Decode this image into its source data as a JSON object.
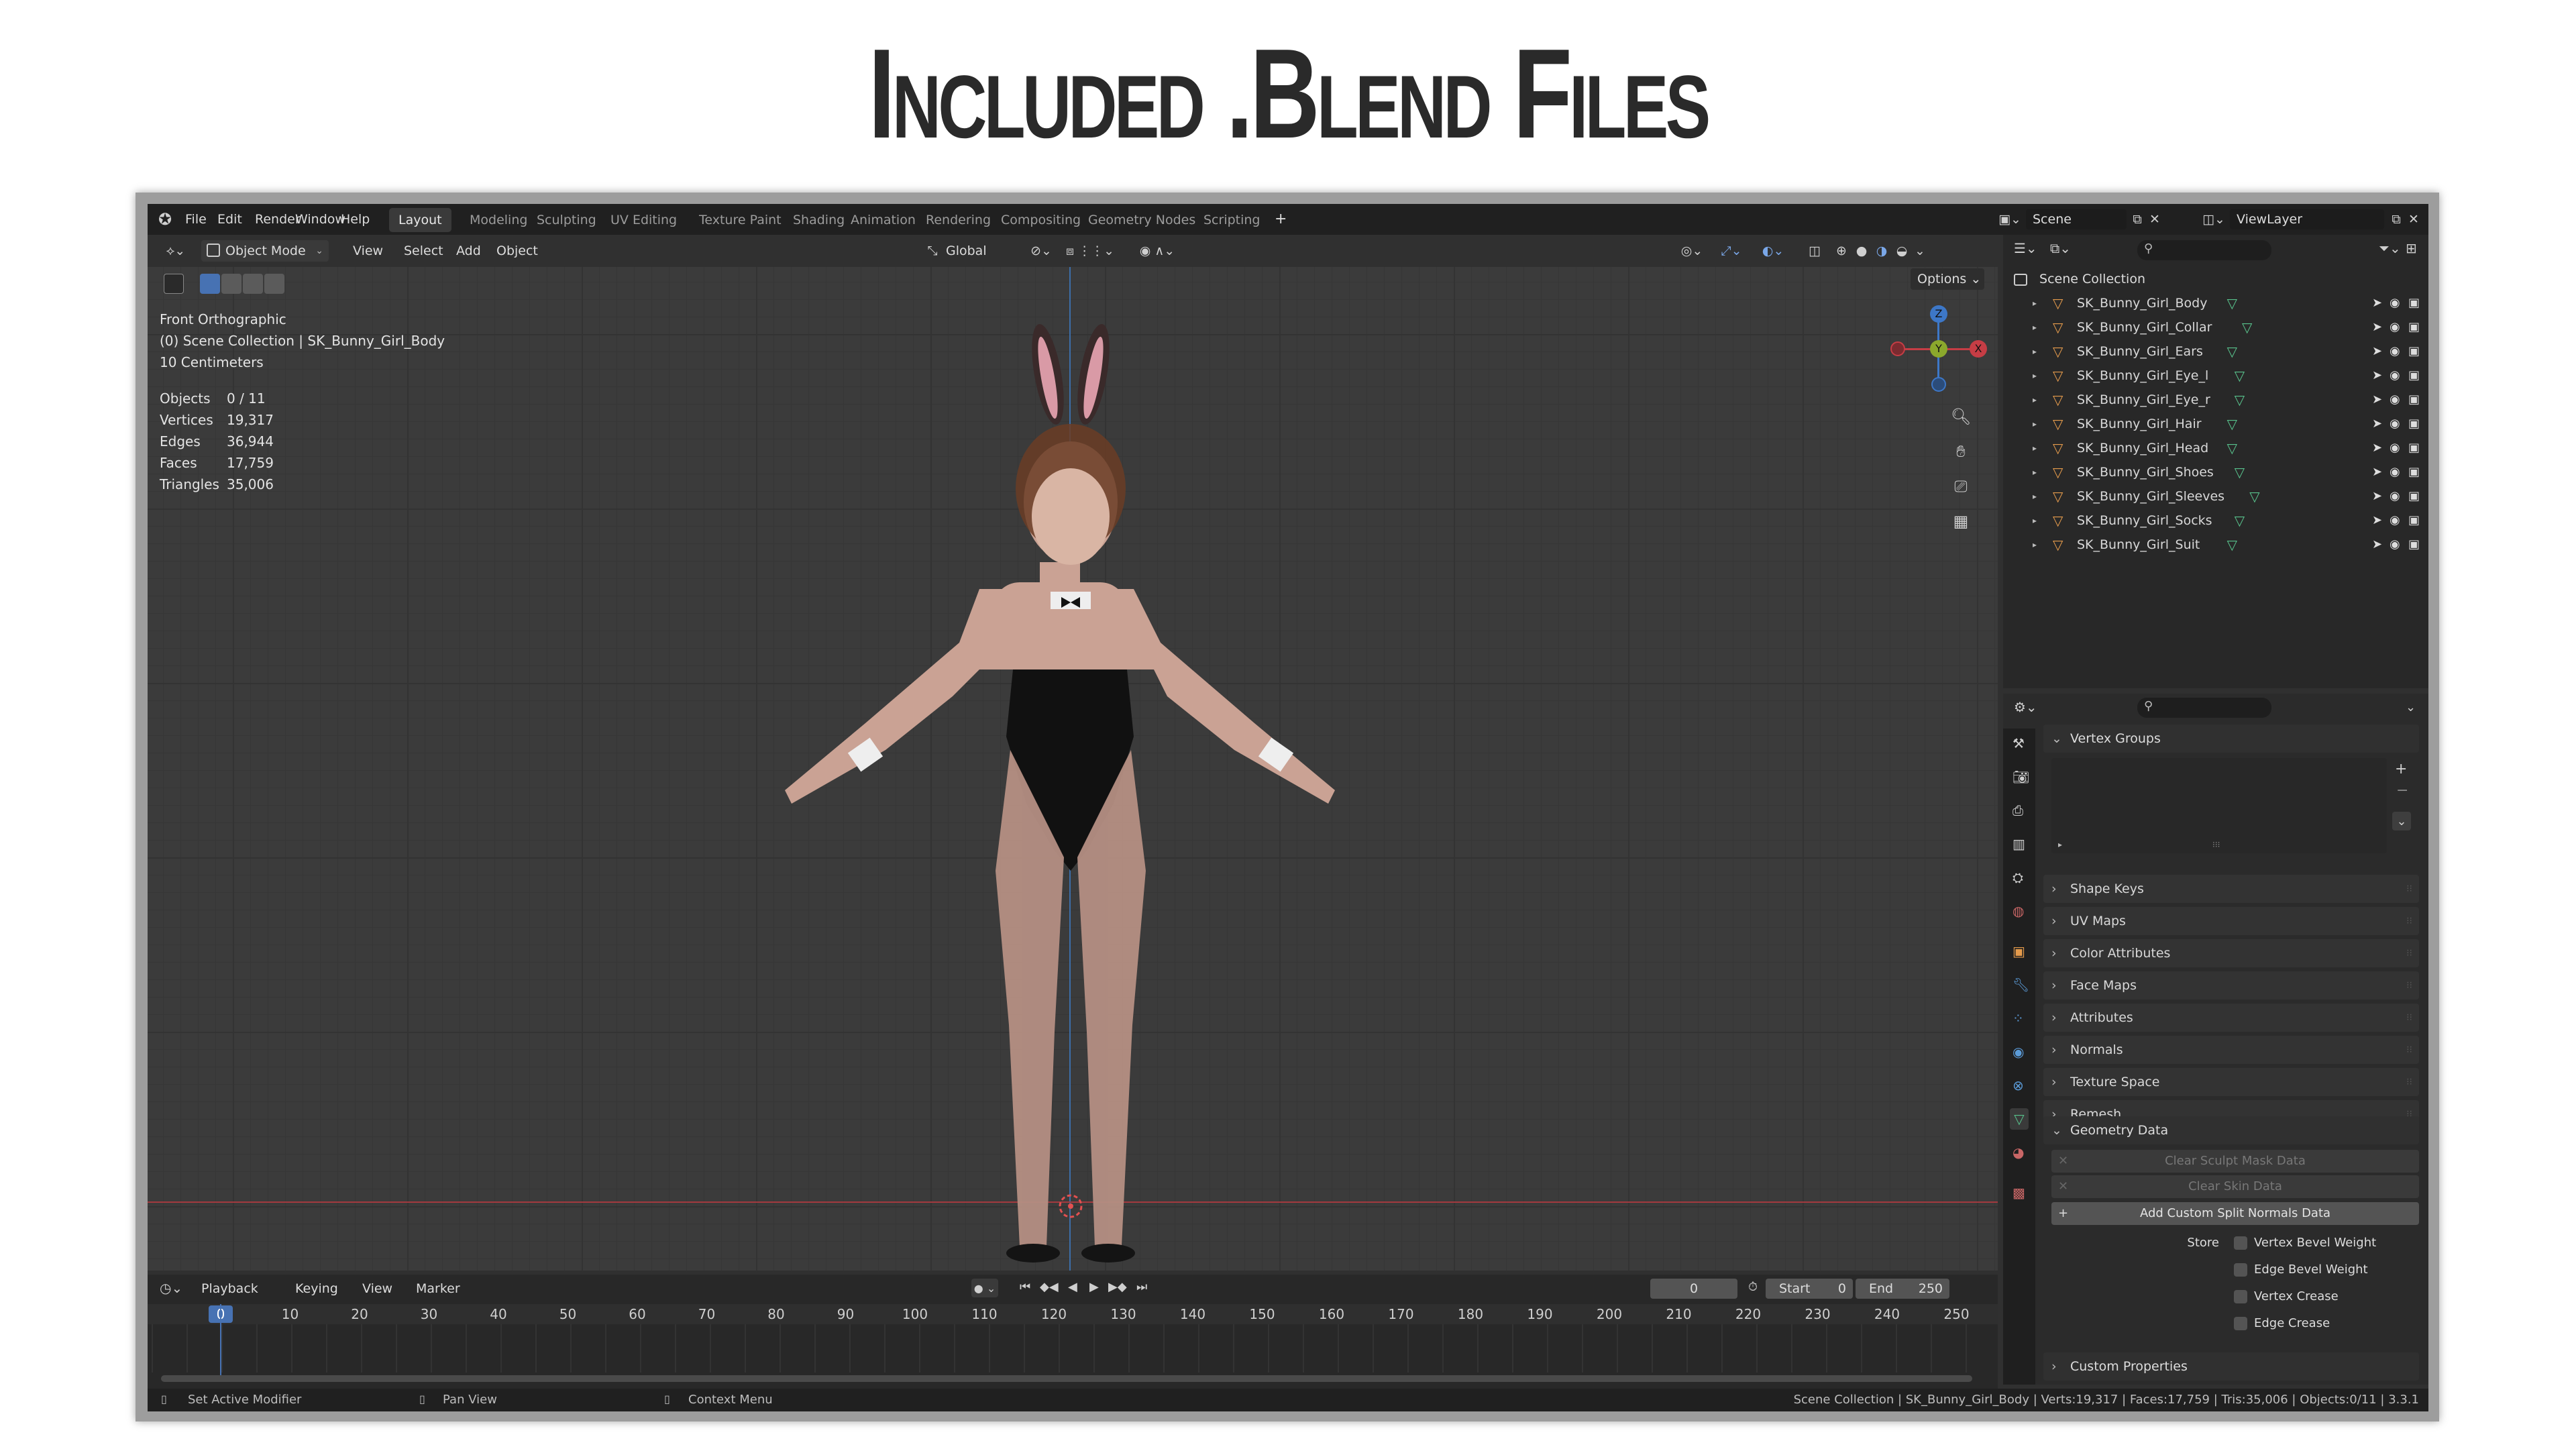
{
  "banner_title": "Included .Blend Files",
  "menu": [
    "File",
    "Edit",
    "Render",
    "Window",
    "Help"
  ],
  "workspaces": [
    {
      "label": "Layout",
      "active": true
    },
    {
      "label": "Modeling"
    },
    {
      "label": "Sculpting"
    },
    {
      "label": "UV Editing"
    },
    {
      "label": "Texture Paint"
    },
    {
      "label": "Shading"
    },
    {
      "label": "Animation"
    },
    {
      "label": "Rendering"
    },
    {
      "label": "Compositing"
    },
    {
      "label": "Geometry Nodes"
    },
    {
      "label": "Scripting"
    }
  ],
  "add_workspace": "+",
  "scene": "Scene",
  "view_layer": "ViewLayer",
  "header3d": {
    "mode": "Object Mode",
    "menus": [
      "View",
      "Select",
      "Add",
      "Object"
    ],
    "orientation": "Global",
    "options": "Options"
  },
  "viewport": {
    "view_name": "Front Orthographic",
    "collection_line": "(0) Scene Collection | SK_Bunny_Girl_Body",
    "scale": "10 Centimeters",
    "stats": [
      {
        "label": "Objects",
        "value": "0 / 11"
      },
      {
        "label": "Vertices",
        "value": "19,317"
      },
      {
        "label": "Edges",
        "value": "36,944"
      },
      {
        "label": "Faces",
        "value": "17,759"
      },
      {
        "label": "Triangles",
        "value": "35,006"
      }
    ],
    "gizmo": {
      "z": "Z",
      "y": "Y",
      "x": "X"
    }
  },
  "outliner": {
    "root": "Scene Collection",
    "items": [
      "SK_Bunny_Girl_Body",
      "SK_Bunny_Girl_Collar",
      "SK_Bunny_Girl_Ears",
      "SK_Bunny_Girl_Eye_l",
      "SK_Bunny_Girl_Eye_r",
      "SK_Bunny_Girl_Hair",
      "SK_Bunny_Girl_Head",
      "SK_Bunny_Girl_Shoes",
      "SK_Bunny_Girl_Sleeves",
      "SK_Bunny_Girl_Socks",
      "SK_Bunny_Girl_Suit"
    ]
  },
  "properties": {
    "vertex_groups": "Vertex Groups",
    "panels": [
      "Shape Keys",
      "UV Maps",
      "Color Attributes",
      "Face Maps",
      "Attributes",
      "Normals",
      "Texture Space",
      "Remesh"
    ],
    "geometry_data": "Geometry Data",
    "clear_sculpt": "Clear Sculpt Mask Data",
    "clear_skin": "Clear Skin Data",
    "add_custom_split": "Add Custom Split Normals Data",
    "store_label": "Store",
    "store_options": [
      "Vertex Bevel Weight",
      "Edge Bevel Weight",
      "Vertex Crease",
      "Edge Crease"
    ],
    "custom_properties": "Custom Properties"
  },
  "timeline": {
    "menus": [
      "Playback",
      "Keying",
      "View",
      "Marker"
    ],
    "current_frame": "0",
    "start_label": "Start",
    "start": "0",
    "end_label": "End",
    "end": "250",
    "ticks": [
      "0",
      "10",
      "20",
      "30",
      "40",
      "50",
      "60",
      "70",
      "80",
      "90",
      "100",
      "110",
      "120",
      "130",
      "140",
      "150",
      "160",
      "170",
      "180",
      "190",
      "200",
      "210",
      "220",
      "230",
      "240",
      "250"
    ]
  },
  "statusbar": {
    "left": "Set Active Modifier",
    "middle": "Pan View",
    "right": "Context Menu",
    "info": "Scene Collection | SK_Bunny_Girl_Body | Verts:19,317 | Faces:17,759 | Tris:35,006 | Objects:0/11 | 3.3.1"
  },
  "colors": {
    "accent": "#4772b3",
    "x_axis": "#c63d45",
    "y_axis": "#8ba82c",
    "z_axis": "#3d77c7",
    "mesh_icon": "#e59b4c",
    "data_icon": "#58c28c"
  }
}
